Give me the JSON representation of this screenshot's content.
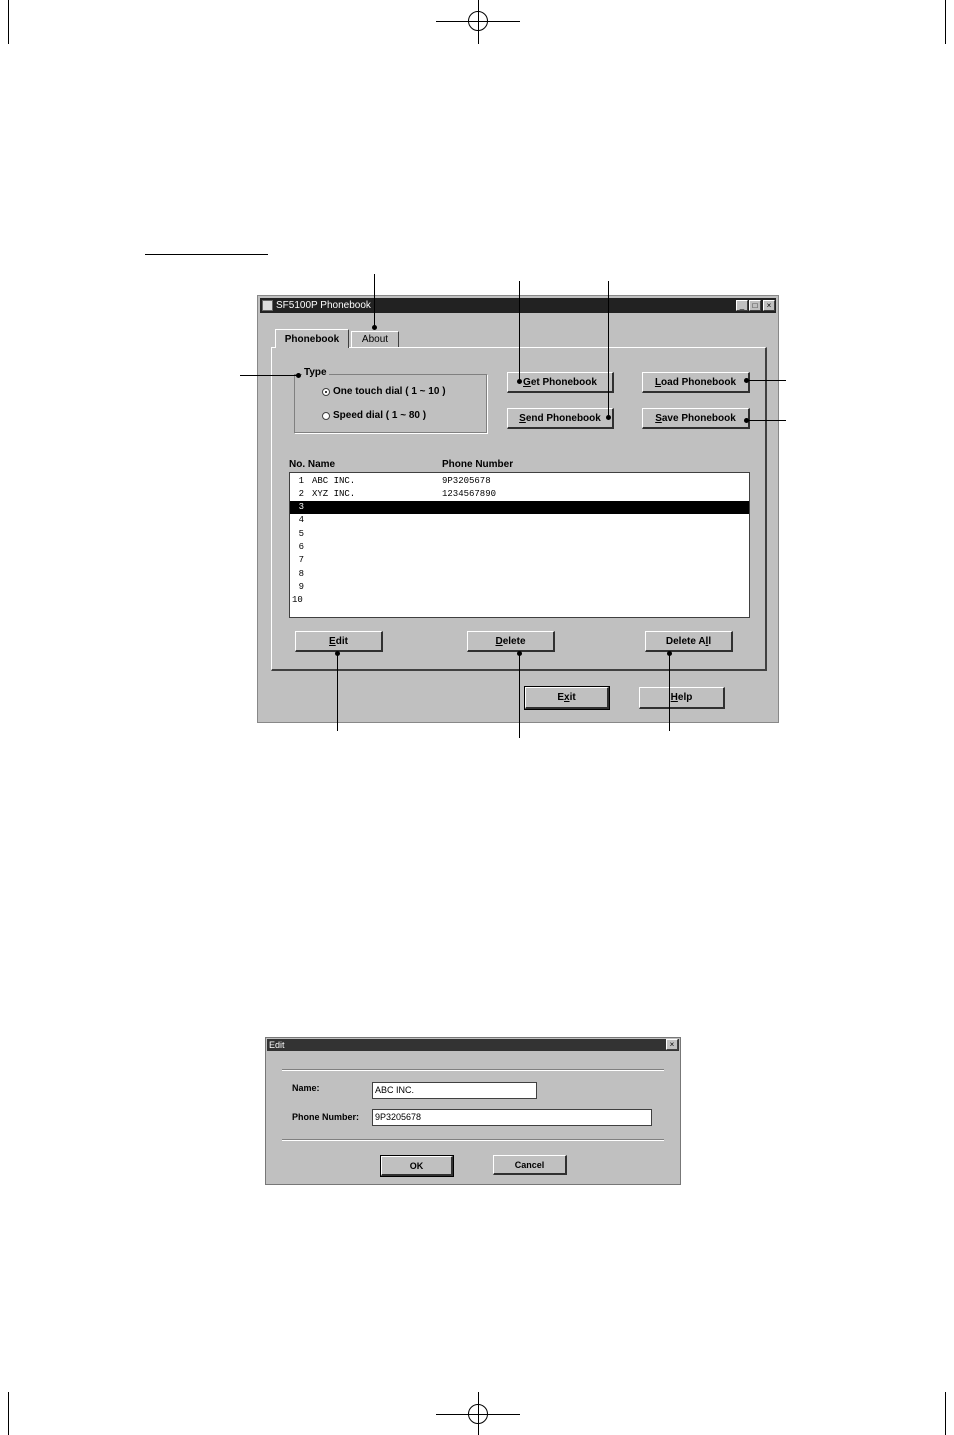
{
  "window": {
    "title": "SF5100P Phonebook",
    "controls": {
      "minimize": "_",
      "maximize": "□",
      "close": "×"
    }
  },
  "tabs": [
    {
      "label": "Phonebook",
      "active": true
    },
    {
      "label": "About",
      "active": false
    }
  ],
  "type_group": {
    "label": "Type",
    "options": [
      {
        "label": "One touch dial ( 1 ~ 10 )",
        "selected": true
      },
      {
        "label": "Speed dial ( 1 ~ 80 )",
        "selected": false
      }
    ]
  },
  "buttons": {
    "get_phonebook": {
      "accel": "G",
      "rest": "et Phonebook"
    },
    "send_phonebook": {
      "accel": "S",
      "rest": "end Phonebook"
    },
    "load_phonebook": {
      "accel": "L",
      "rest": "oad Phonebook"
    },
    "save_phonebook": {
      "accel": "S",
      "rest": "ave Phonebook"
    },
    "edit": {
      "accel": "E",
      "rest": "dit"
    },
    "delete": {
      "accel": "D",
      "rest": "elete"
    },
    "delete_all": {
      "pre": "Delete A",
      "accel": "l",
      "rest": "l"
    },
    "exit": {
      "pre": "E",
      "accel": "x",
      "rest": "it"
    },
    "help": {
      "accel": "H",
      "rest": "elp"
    }
  },
  "list": {
    "headers": {
      "no_name": "No. Name",
      "phone": "Phone Number"
    },
    "rows": [
      {
        "no": "1",
        "name": "ABC INC.",
        "phone": "9P3205678"
      },
      {
        "no": "2",
        "name": "XYZ INC.",
        "phone": "1234567890"
      },
      {
        "no": "3",
        "name": "",
        "phone": "",
        "selected": true
      },
      {
        "no": "4",
        "name": "",
        "phone": ""
      },
      {
        "no": "5",
        "name": "",
        "phone": ""
      },
      {
        "no": "6",
        "name": "",
        "phone": ""
      },
      {
        "no": "7",
        "name": "",
        "phone": ""
      },
      {
        "no": "8",
        "name": "",
        "phone": ""
      },
      {
        "no": "9",
        "name": "",
        "phone": ""
      },
      {
        "no": "10",
        "name": "",
        "phone": ""
      }
    ]
  },
  "edit_dialog": {
    "title": "Edit",
    "close": "×",
    "name_label": "Name:",
    "name_value": "ABC INC.",
    "phone_label": "Phone Number:",
    "phone_value": "9P3205678",
    "ok": "OK",
    "cancel": "Cancel"
  }
}
